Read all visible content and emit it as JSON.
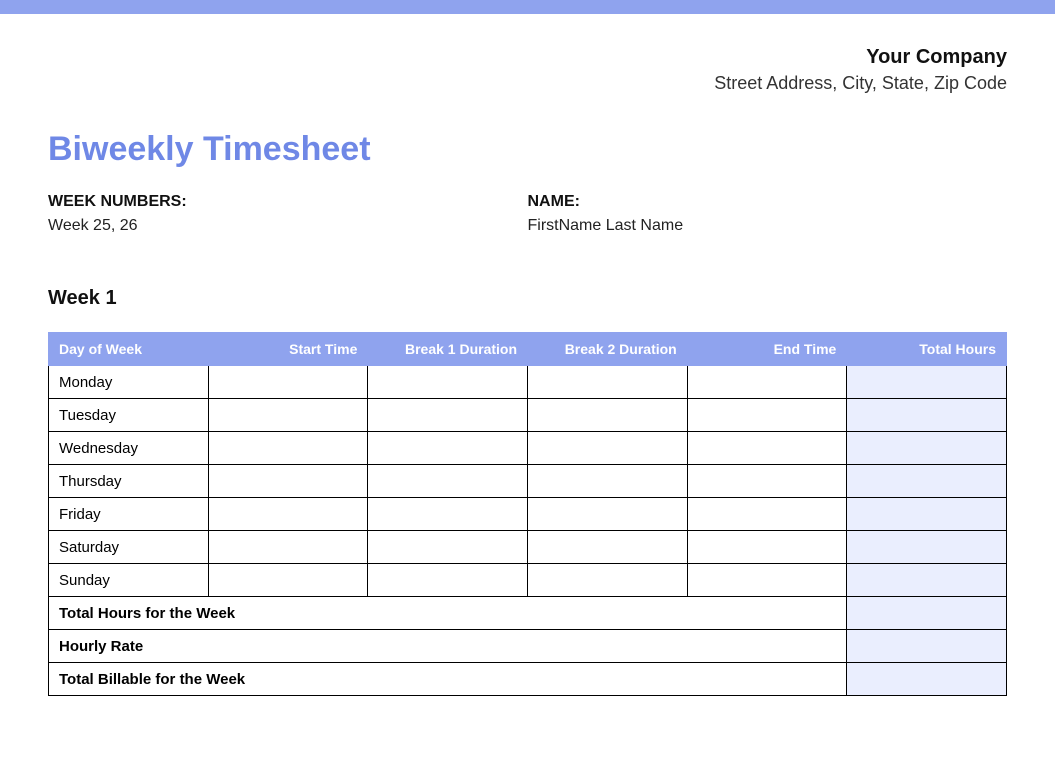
{
  "company": {
    "name": "Your Company",
    "address": "Street Address, City, State, Zip Code"
  },
  "title": "Biweekly Timesheet",
  "info": {
    "week_numbers_label": "WEEK NUMBERS:",
    "week_numbers_value": "Week 25, 26",
    "name_label": "NAME:",
    "name_value": "FirstName Last Name"
  },
  "week_heading": "Week 1",
  "columns": {
    "day": "Day of Week",
    "start": "Start Time",
    "break1": "Break 1 Duration",
    "break2": "Break 2 Duration",
    "end": "End Time",
    "total": "Total Hours"
  },
  "days": {
    "mon": "Monday",
    "tue": "Tuesday",
    "wed": "Wednesday",
    "thu": "Thursday",
    "fri": "Friday",
    "sat": "Saturday",
    "sun": "Sunday"
  },
  "summary": {
    "total_hours": "Total Hours for the Week",
    "hourly_rate": "Hourly Rate",
    "total_billable": "Total Billable for the Week"
  }
}
